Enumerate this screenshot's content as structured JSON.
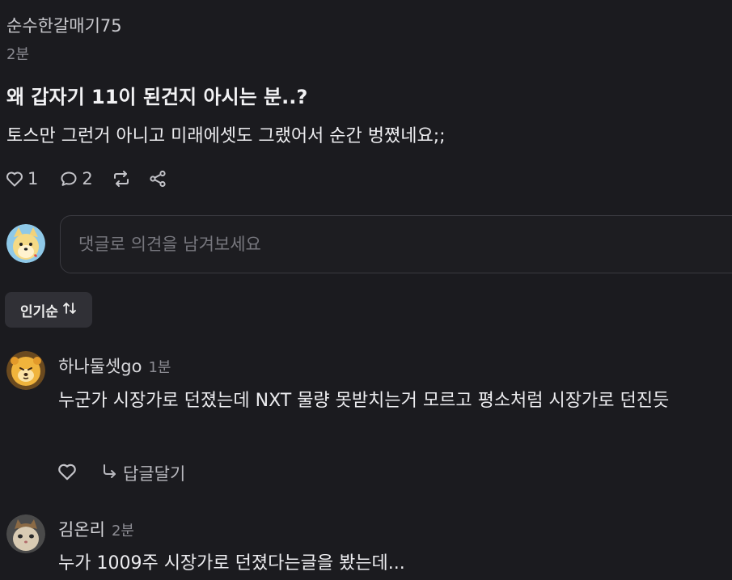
{
  "post": {
    "author": "순수한갈매기75",
    "time": "2분",
    "title": "왜 갑자기 11이 된건지 아시는 분..?",
    "body": "토스만 그런거 아니고 미래에셋도 그랬어서 순간 벙쪘네요;;",
    "like_count": "1",
    "comment_count": "2"
  },
  "composer": {
    "placeholder": "댓글로 의견을 남겨보세요"
  },
  "sort": {
    "label": "인기순",
    "icon": "sort-arrows-icon"
  },
  "comments": [
    {
      "author": "하나둘셋go",
      "time": "1분",
      "text": "누군가 시장가로 던졌는데 NXT 물량 못받치는거 모르고 평소처럼 시장가로 던진듯",
      "reply_label": "답글달기"
    },
    {
      "author": "김온리",
      "time": "2분",
      "text": "누가 1009주 시장가로 던졌다는글을 봤는데..."
    }
  ],
  "colors": {
    "background": "#1b1b1f",
    "input_border": "#3a3a40",
    "sort_bg": "#303036"
  }
}
